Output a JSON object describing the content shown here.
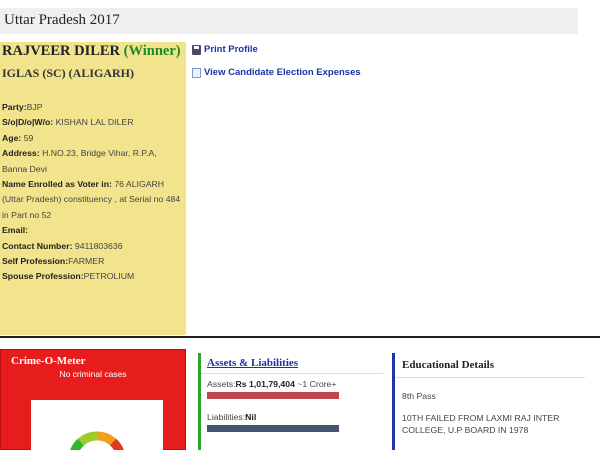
{
  "header": {
    "title": "Uttar Pradesh 2017"
  },
  "candidate": {
    "name": "RAJVEER DILER",
    "status": "(Winner)",
    "constituency": "IGLAS (SC) (ALIGARH)",
    "details": [
      {
        "label": "Party:",
        "value": "BJP"
      },
      {
        "label": "S/o|D/o|W/o:",
        "value": " KISHAN LAL DILER"
      },
      {
        "label": "Age:",
        "value": " 59"
      },
      {
        "label": "Address:",
        "value": " H.NO.23, Bridge Vihar, R.P.A, Banna Devi"
      },
      {
        "label": "Name Enrolled as Voter in:",
        "value": " 76 ALIGARH (Uttar Pradesh) constituency , at Serial no 484 in Part no 52"
      },
      {
        "label": "Email:",
        "value": ""
      },
      {
        "label": "Contact Number:",
        "value": " 9411803636"
      },
      {
        "label": "Self Profession:",
        "value": "FARMER"
      },
      {
        "label": "Spouse Profession:",
        "value": "PETROLIUM"
      }
    ]
  },
  "links": {
    "print_profile": "Print Profile",
    "expenses": "View Candidate Election Expenses"
  },
  "crime": {
    "title": "Crime-O-Meter",
    "subtitle": "No criminal cases"
  },
  "assets": {
    "title": "Assets & Liabilities",
    "assets_label": "Assets:",
    "assets_value": "Rs 1,01,79,404",
    "assets_note": " ~1 Crore+",
    "liabilities_label": "Liabilities:",
    "liabilities_value": "Nil"
  },
  "education": {
    "title": "Educational Details",
    "level": "8th Pass",
    "detail": "10TH FAILED FROM LAXMI RAJ INTER COLLEGE, U.P BOARD IN 1978"
  },
  "colors": {
    "panel_yellow": "#f1e48c",
    "winner_green": "#1d8a2a",
    "crime_red": "#e71d1d",
    "link_blue": "#1a33aa"
  }
}
